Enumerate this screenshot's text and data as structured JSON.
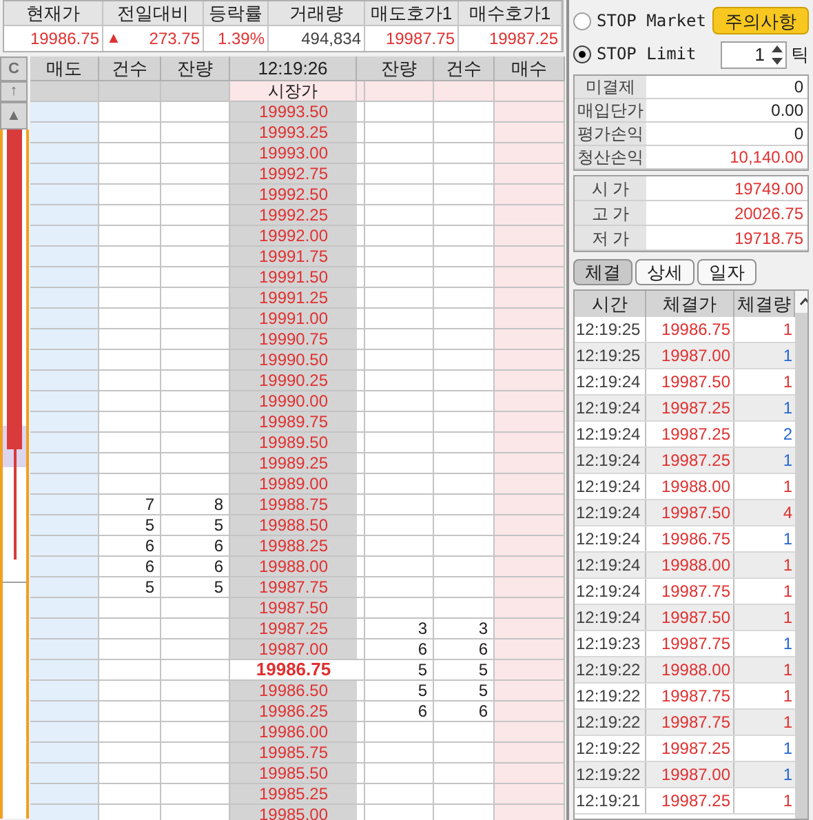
{
  "quote": [
    {
      "label": "현재가",
      "value": "19986.75",
      "color": "#e03030"
    },
    {
      "label": "전일대비",
      "sign": "▲",
      "value": "273.75",
      "color": "#e03030"
    },
    {
      "label": "등락률",
      "value": "1.39%",
      "color": "#e03030"
    },
    {
      "label": "거래량",
      "value": "494,834",
      "color": "#404040"
    },
    {
      "label": "매도호가1",
      "value": "19987.75",
      "color": "#e03030"
    },
    {
      "label": "매수호가1",
      "value": "19987.25",
      "color": "#e03030"
    }
  ],
  "ladder": {
    "strip_buttons": [
      "C",
      "↑",
      "▲"
    ],
    "columns": [
      "매도",
      "건수",
      "잔량",
      "12:19:26",
      "잔량",
      "건수",
      "매수"
    ],
    "market_label": "시장가",
    "ask_rows": [
      {
        "price": "19993.50",
        "current": false
      },
      {
        "price": "19993.25",
        "current": false
      },
      {
        "price": "19993.00",
        "current": false
      },
      {
        "price": "19992.75",
        "current": false
      },
      {
        "price": "19992.50",
        "current": false
      },
      {
        "price": "19992.25",
        "current": false
      },
      {
        "price": "19992.00",
        "current": false
      },
      {
        "price": "19991.75",
        "current": false
      },
      {
        "price": "19991.50",
        "current": false
      },
      {
        "price": "19991.25",
        "current": false
      },
      {
        "price": "19991.00",
        "current": false
      },
      {
        "price": "19990.75",
        "current": false
      },
      {
        "price": "19990.50",
        "current": false
      },
      {
        "price": "19990.25",
        "current": false
      },
      {
        "price": "19990.00",
        "current": false
      },
      {
        "price": "19989.75",
        "current": false
      },
      {
        "price": "19989.50",
        "current": false
      },
      {
        "price": "19989.25",
        "current": false
      },
      {
        "price": "19989.00",
        "current": false
      },
      {
        "price": "19988.75",
        "sell_count": "7",
        "sell_qty": "8",
        "current": false
      },
      {
        "price": "19988.50",
        "sell_count": "5",
        "sell_qty": "5",
        "current": false
      },
      {
        "price": "19988.25",
        "sell_count": "6",
        "sell_qty": "6",
        "current": false
      },
      {
        "price": "19988.00",
        "sell_count": "6",
        "sell_qty": "6",
        "current": false
      },
      {
        "price": "19987.75",
        "sell_count": "5",
        "sell_qty": "5",
        "current": false
      }
    ],
    "bid_rows": [
      {
        "price": "19987.50",
        "current": false
      },
      {
        "price": "19987.25",
        "buy_qty": "3",
        "buy_count": "3",
        "current": false
      },
      {
        "price": "19987.00",
        "buy_qty": "6",
        "buy_count": "6",
        "current": false
      },
      {
        "price": "19986.75",
        "buy_qty": "5",
        "buy_count": "5",
        "current": true
      },
      {
        "price": "19986.50",
        "buy_qty": "5",
        "buy_count": "5",
        "current": false
      },
      {
        "price": "19986.25",
        "buy_qty": "6",
        "buy_count": "6",
        "current": false
      },
      {
        "price": "19986.00",
        "current": false
      },
      {
        "price": "19985.75",
        "current": false
      },
      {
        "price": "19985.50",
        "current": false
      },
      {
        "price": "19985.25",
        "current": false
      },
      {
        "price": "19985.00",
        "current": false
      }
    ]
  },
  "stop": {
    "options": [
      {
        "label": "STOP Market",
        "selected": false
      },
      {
        "label": "STOP Limit",
        "selected": true
      }
    ],
    "notice_button": "주의사항",
    "tick_value": "1",
    "tick_unit": "틱"
  },
  "position": [
    {
      "label": "미결제",
      "value": "0",
      "color": "#202020"
    },
    {
      "label": "매입단가",
      "value": "0.00",
      "color": "#202020"
    },
    {
      "label": "평가손익",
      "value": "0",
      "color": "#202020"
    },
    {
      "label": "청산손익",
      "value": "10,140.00",
      "color": "#e03030"
    }
  ],
  "prices": [
    {
      "label": "시 가",
      "value": "19749.00"
    },
    {
      "label": "고 가",
      "value": "20026.75"
    },
    {
      "label": "저 가",
      "value": "19718.75"
    }
  ],
  "tabs": [
    {
      "label": "체결",
      "selected": true
    },
    {
      "label": "상세",
      "selected": false
    },
    {
      "label": "일자",
      "selected": false
    }
  ],
  "trades": {
    "columns": [
      "시간",
      "체결가",
      "체결량"
    ],
    "rows": [
      {
        "time": "12:19:25",
        "price": "19986.75",
        "qty": "1",
        "color": "#e03030"
      },
      {
        "time": "12:19:25",
        "price": "19987.00",
        "qty": "1",
        "color": "#2266d0"
      },
      {
        "time": "12:19:24",
        "price": "19987.50",
        "qty": "1",
        "color": "#e03030"
      },
      {
        "time": "12:19:24",
        "price": "19987.25",
        "qty": "1",
        "color": "#2266d0"
      },
      {
        "time": "12:19:24",
        "price": "19987.25",
        "qty": "2",
        "color": "#2266d0"
      },
      {
        "time": "12:19:24",
        "price": "19987.25",
        "qty": "1",
        "color": "#2266d0"
      },
      {
        "time": "12:19:24",
        "price": "19988.00",
        "qty": "1",
        "color": "#e03030"
      },
      {
        "time": "12:19:24",
        "price": "19987.50",
        "qty": "4",
        "color": "#e03030"
      },
      {
        "time": "12:19:24",
        "price": "19986.75",
        "qty": "1",
        "color": "#2266d0"
      },
      {
        "time": "12:19:24",
        "price": "19988.00",
        "qty": "1",
        "color": "#e03030"
      },
      {
        "time": "12:19:24",
        "price": "19987.75",
        "qty": "1",
        "color": "#e03030"
      },
      {
        "time": "12:19:24",
        "price": "19987.50",
        "qty": "1",
        "color": "#e03030"
      },
      {
        "time": "12:19:23",
        "price": "19987.75",
        "qty": "1",
        "color": "#2266d0"
      },
      {
        "time": "12:19:22",
        "price": "19988.00",
        "qty": "1",
        "color": "#e03030"
      },
      {
        "time": "12:19:22",
        "price": "19987.75",
        "qty": "1",
        "color": "#e03030"
      },
      {
        "time": "12:19:22",
        "price": "19987.75",
        "qty": "1",
        "color": "#e03030"
      },
      {
        "time": "12:19:22",
        "price": "19987.25",
        "qty": "1",
        "color": "#2266d0"
      },
      {
        "time": "12:19:22",
        "price": "19987.00",
        "qty": "1",
        "color": "#2266d0"
      },
      {
        "time": "12:19:21",
        "price": "19987.25",
        "qty": "1",
        "color": "#e03030"
      }
    ]
  }
}
